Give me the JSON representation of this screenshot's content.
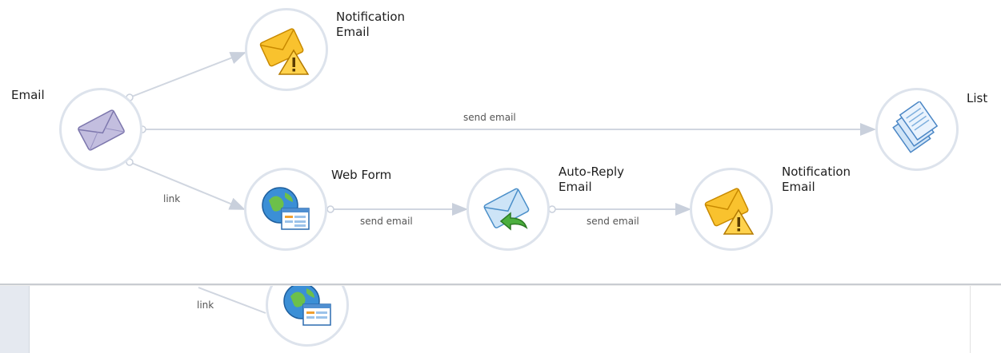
{
  "nodes": {
    "email": {
      "label": "Email",
      "icon": "envelope-icon"
    },
    "notification_top": {
      "label": "Notification\nEmail",
      "icon": "warning-envelope-icon"
    },
    "list": {
      "label": "List",
      "icon": "documents-icon"
    },
    "web_form": {
      "label": "Web Form",
      "icon": "web-form-icon"
    },
    "auto_reply": {
      "label": "Auto-Reply\nEmail",
      "icon": "reply-envelope-icon"
    },
    "notification_bottom": {
      "label": "Notification\nEmail",
      "icon": "warning-envelope-icon"
    }
  },
  "edges": {
    "email_to_list": "send email",
    "email_to_webform": "link",
    "webform_to_autoreply": "send email",
    "autoreply_to_notification": "send email"
  },
  "lower_panel": {
    "link_label": "link",
    "node_icon": "web-form-icon"
  },
  "colors": {
    "node_border": "#dde3ec",
    "connector": "#c9d0dc",
    "warning_yellow": "#f7b500",
    "globe_blue": "#3b8fd6",
    "envelope_purple": "#a39cc9"
  }
}
